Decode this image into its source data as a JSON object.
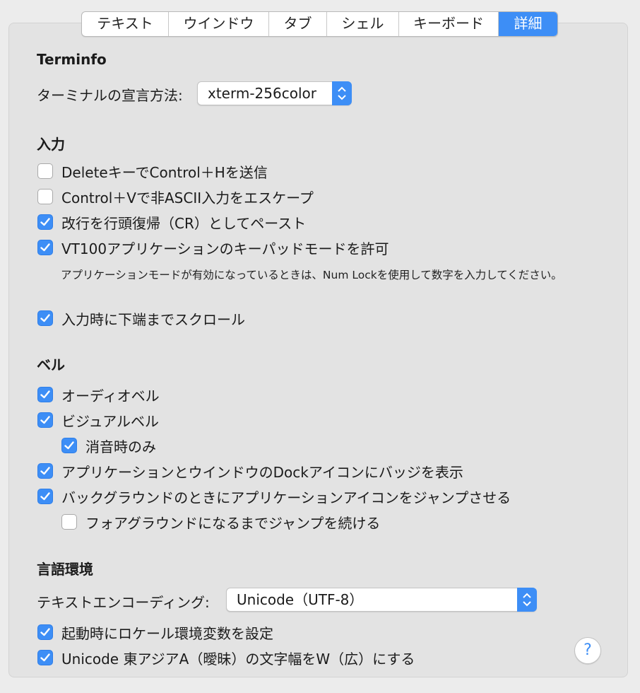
{
  "tabs": [
    {
      "label": "テキスト",
      "active": false
    },
    {
      "label": "ウインドウ",
      "active": false
    },
    {
      "label": "タブ",
      "active": false
    },
    {
      "label": "シェル",
      "active": false
    },
    {
      "label": "キーボード",
      "active": false
    },
    {
      "label": "詳細",
      "active": true
    }
  ],
  "terminfo": {
    "heading": "Terminfo",
    "declare_label": "ターミナルの宣言方法:",
    "declare_value": "xterm-256color"
  },
  "input": {
    "heading": "入力",
    "options": [
      {
        "label": "DeleteキーでControl＋Hを送信",
        "checked": false
      },
      {
        "label": "Control＋Vで非ASCII入力をエスケープ",
        "checked": false
      },
      {
        "label": "改行を行頭復帰（CR）としてペースト",
        "checked": true
      },
      {
        "label": "VT100アプリケーションのキーパッドモードを許可",
        "checked": true
      },
      {
        "label": "入力時に下端までスクロール",
        "checked": true
      }
    ],
    "note": "アプリケーションモードが有効になっているときは、Num Lockを使用して数字を入力してください。"
  },
  "bell": {
    "heading": "ベル",
    "options": [
      {
        "label": "オーディオベル",
        "checked": true
      },
      {
        "label": "ビジュアルベル",
        "checked": true
      },
      {
        "label": "消音時のみ",
        "checked": true
      },
      {
        "label": "アプリケーションとウインドウのDockアイコンにバッジを表示",
        "checked": true
      },
      {
        "label": "バックグラウンドのときにアプリケーションアイコンをジャンプさせる",
        "checked": true
      },
      {
        "label": "フォアグラウンドになるまでジャンプを続ける",
        "checked": false
      }
    ]
  },
  "language": {
    "heading": "言語環境",
    "encoding_label": "テキストエンコーディング:",
    "encoding_value": "Unicode（UTF-8）",
    "options": [
      {
        "label": "起動時にロケール環境変数を設定",
        "checked": true
      },
      {
        "label": "Unicode 東アジアA（曖昧）の文字幅をW（広）にする",
        "checked": true
      }
    ]
  },
  "help": {
    "label": "?"
  },
  "colors": {
    "accent": "#3d8ef6",
    "panel": "#e3e3e3",
    "window": "#ececec"
  }
}
